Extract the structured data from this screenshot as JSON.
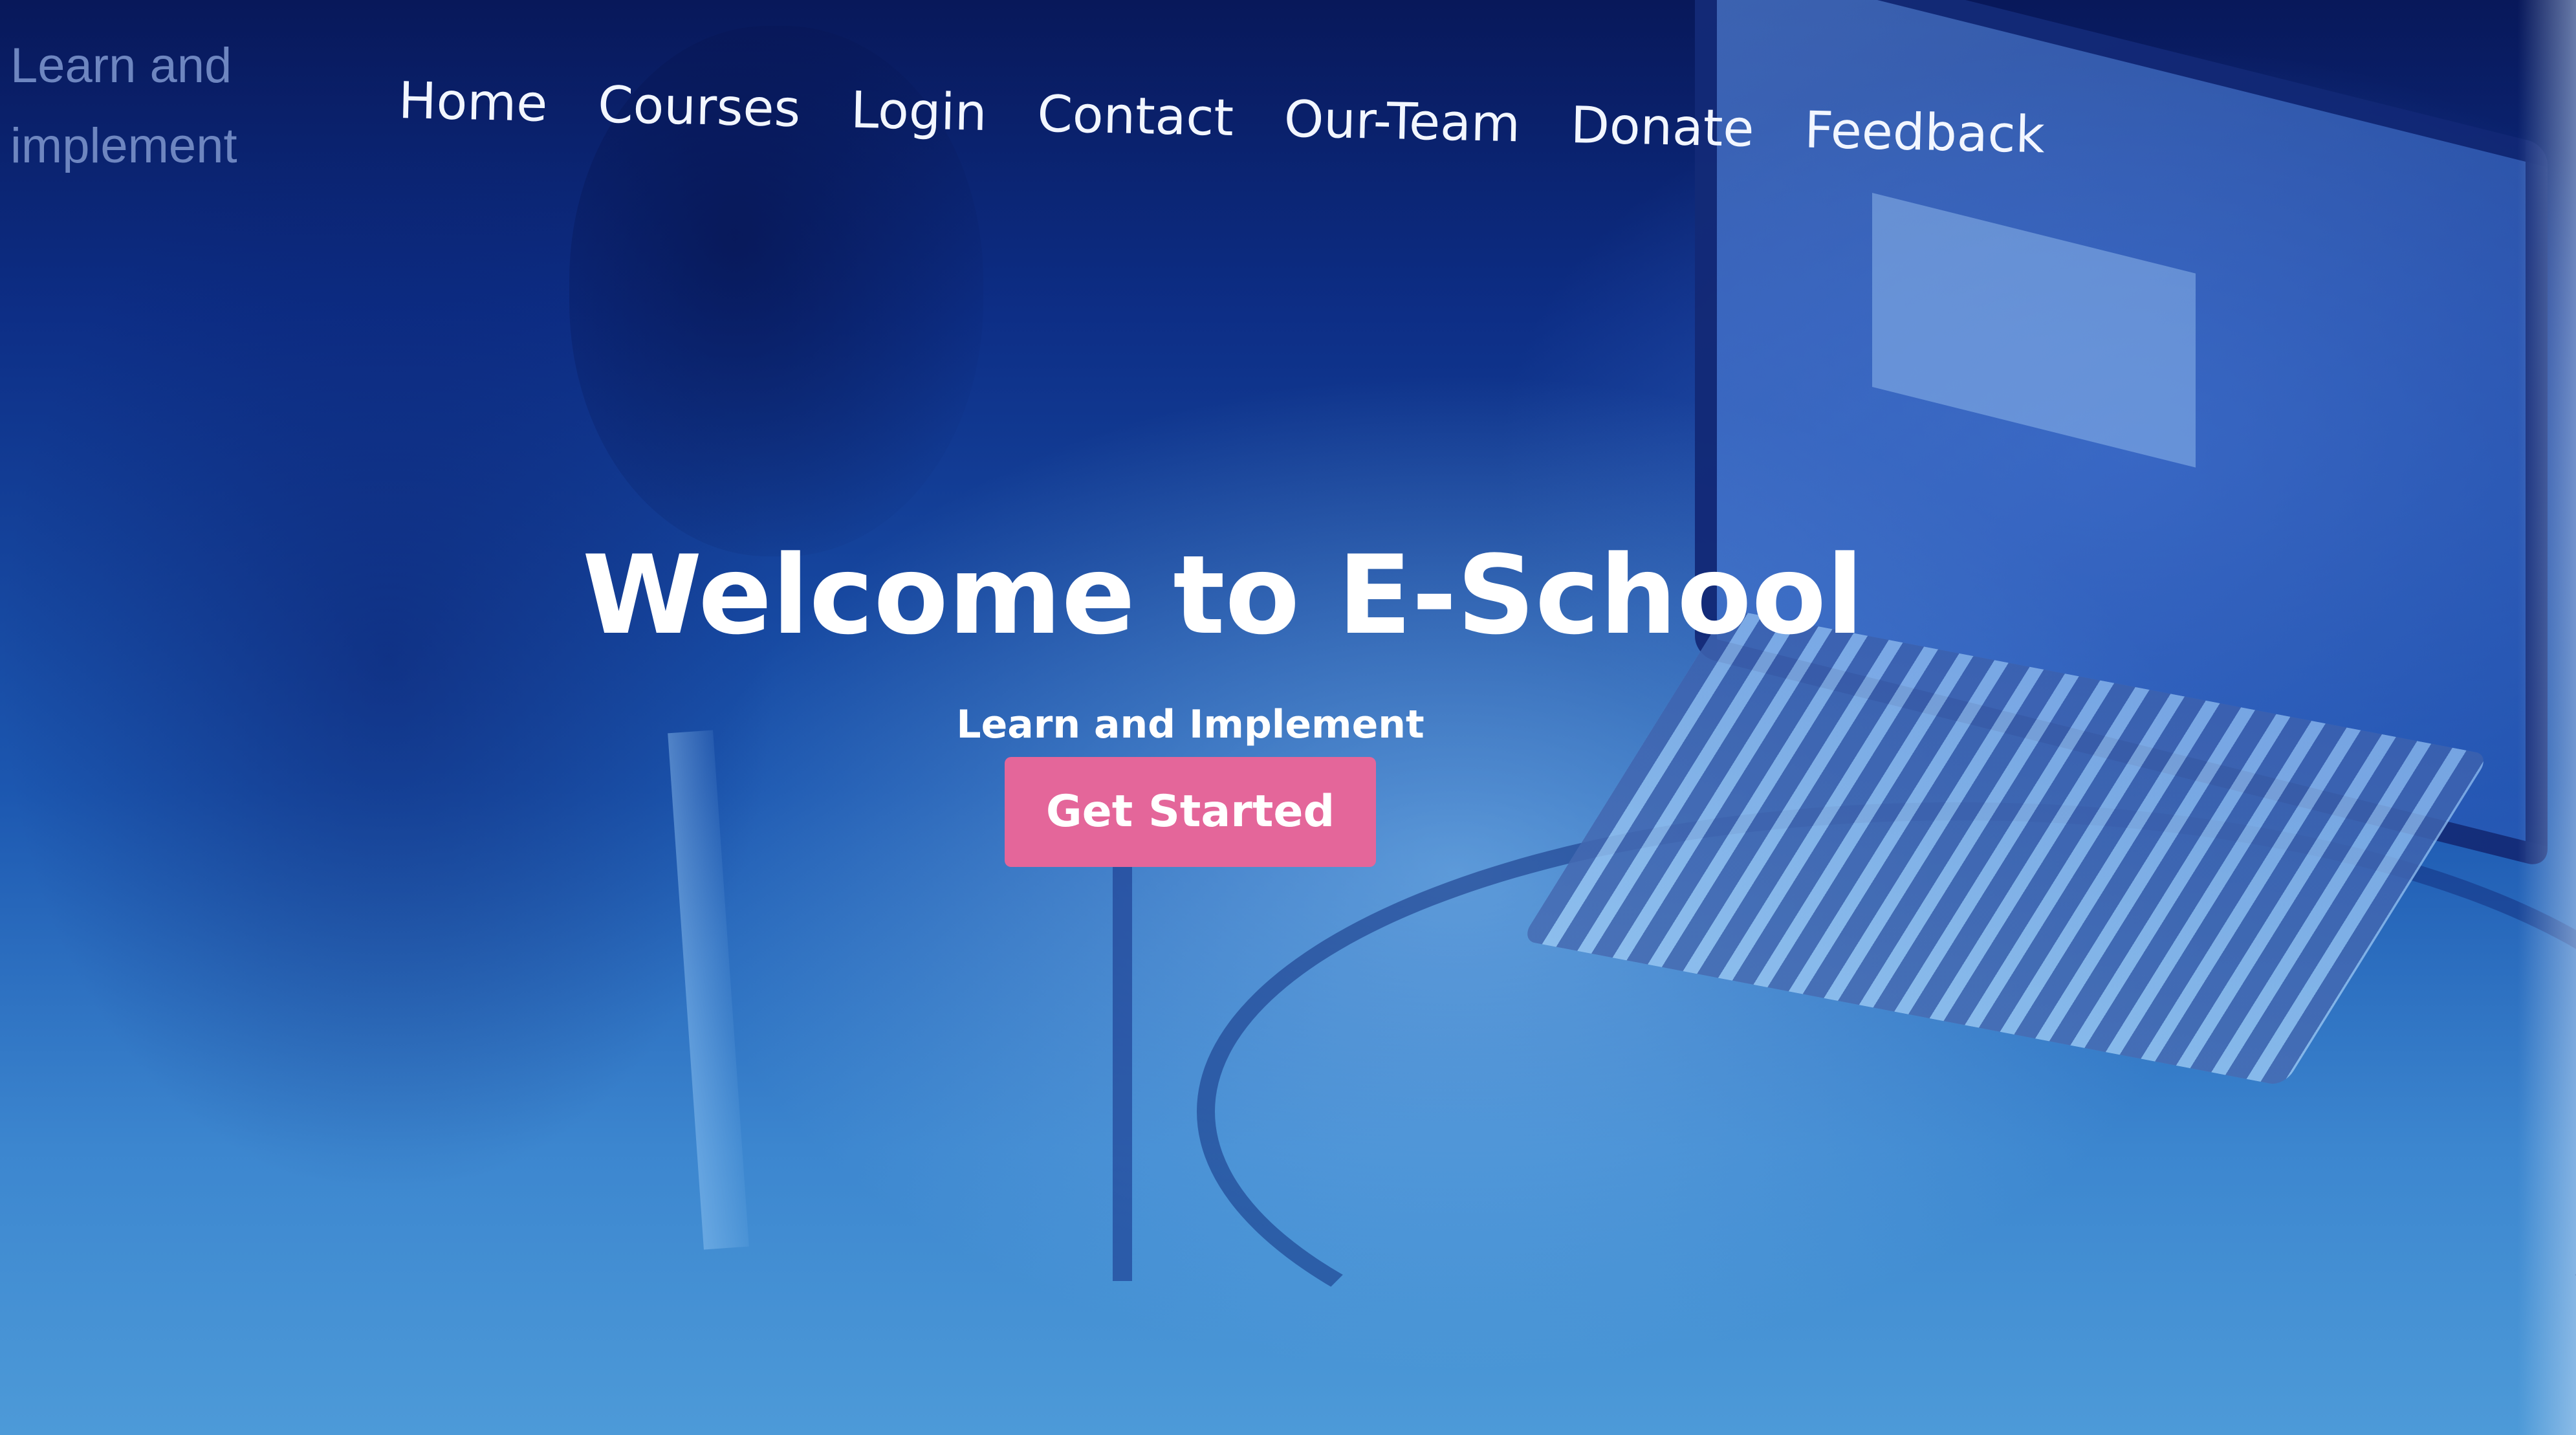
{
  "brand": {
    "line1": "Learn and",
    "line2": "implement",
    "color": "#6e86c0"
  },
  "nav": {
    "items": [
      {
        "label": "Home"
      },
      {
        "label": "Courses"
      },
      {
        "label": "Login"
      },
      {
        "label": "Contact"
      },
      {
        "label": "Our-Team"
      },
      {
        "label": "Donate"
      },
      {
        "label": "Feedback"
      }
    ]
  },
  "hero": {
    "title": "Welcome to E-School",
    "subtitle": "Learn and Implement",
    "cta_label": "Get Started",
    "cta_color": "#e4669a"
  },
  "theme": {
    "background_top": "#08185a",
    "background_bottom": "#4d9ad8",
    "text_color": "#ffffff"
  }
}
